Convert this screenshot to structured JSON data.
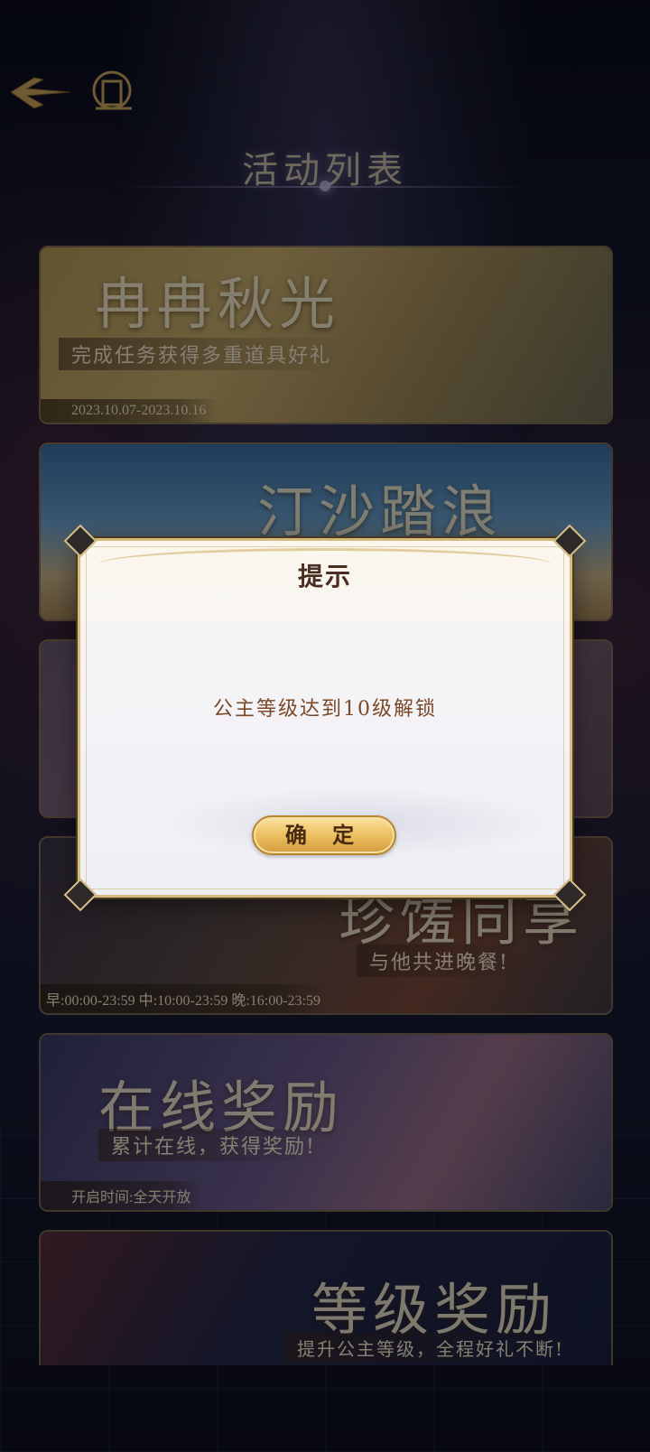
{
  "header": {
    "title": "活动列表",
    "back_icon": "back-arrow-icon",
    "home_icon": "home-emblem-icon"
  },
  "activities": [
    {
      "name": "冉冉秋光",
      "subtitle": "完成任务获得多重道具好礼",
      "time": "2023.10.07-2023.10.16"
    },
    {
      "name": "汀沙踏浪",
      "subtitle": "",
      "time": ""
    },
    {
      "name": "",
      "subtitle": "",
      "time": ""
    },
    {
      "name": "珍馐同享",
      "subtitle": "与他共进晚餐!",
      "time": "早:00:00-23:59 中:10:00-23:59 晚:16:00-23:59"
    },
    {
      "name": "在线奖励",
      "subtitle": "累计在线，获得奖励!",
      "time": "开启时间:全天开放"
    },
    {
      "name": "等级奖励",
      "subtitle": "提升公主等级，全程好礼不断!",
      "time": ""
    }
  ],
  "dialog": {
    "title": "提示",
    "message": "公主等级达到10级解锁",
    "confirm_label": "确 定"
  },
  "colors": {
    "gold_border": "#d7bb7c",
    "button_gold": "#e9bd5c",
    "dialog_title": "#4a2e22",
    "dialog_text": "#7a4a28"
  }
}
